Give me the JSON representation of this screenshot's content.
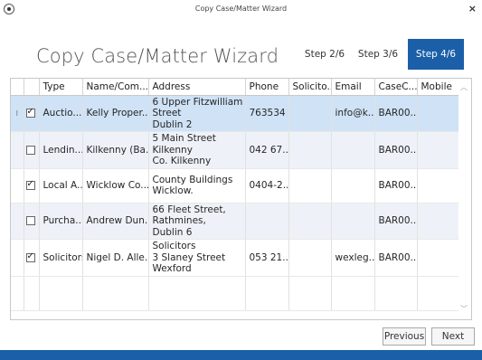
{
  "window": {
    "title": "Copy Case/Matter Wizard",
    "close": "×"
  },
  "heading": "Copy Case/Matter Wizard",
  "steps": [
    {
      "label": "Step 2/6"
    },
    {
      "label": "Step 3/6"
    },
    {
      "label": "Step 4/6"
    }
  ],
  "columns": [
    "Type",
    "Name/Com...",
    "Address",
    "Phone",
    "Solicito...",
    "Email",
    "CaseC...",
    "Mobile"
  ],
  "rows": [
    {
      "indicator": "I",
      "checked": true,
      "type": "Auctio...",
      "name": "Kelly Proper...",
      "address": [
        "6 Upper Fitzwilliam",
        "Street",
        "Dublin 2"
      ],
      "phone": "763534",
      "solicitor": "",
      "email": "info@k...",
      "casec": "BAR00...",
      "mobile": ""
    },
    {
      "indicator": "",
      "checked": false,
      "type": "Lendin...",
      "name": "Kilkenny (Ba...",
      "address": [
        "5 Main Street",
        "Kilkenny",
        "Co. Kilkenny"
      ],
      "phone": "042 67...",
      "solicitor": "",
      "email": "",
      "casec": "BAR00...",
      "mobile": ""
    },
    {
      "indicator": "",
      "checked": true,
      "type": "Local A...",
      "name": "Wicklow Co...",
      "address": [
        "County Buildings",
        "Wicklow."
      ],
      "phone": "0404-2...",
      "solicitor": "",
      "email": "",
      "casec": "BAR00...",
      "mobile": ""
    },
    {
      "indicator": "",
      "checked": false,
      "type": "Purcha...",
      "name": "Andrew Dun...",
      "address": [
        "66 Fleet Street,",
        "Rathmines,",
        "Dublin 6"
      ],
      "phone": "",
      "solicitor": "",
      "email": "",
      "casec": "BAR00...",
      "mobile": ""
    },
    {
      "indicator": "",
      "checked": true,
      "type": "Solicitors",
      "name": "Nigel D. Alle...",
      "address": [
        "Solicitors",
        "3 Slaney Street",
        "Wexford"
      ],
      "phone": "053 21...",
      "solicitor": "",
      "email": "wexleg...",
      "casec": "BAR00...",
      "mobile": ""
    }
  ],
  "buttons": {
    "previous": "Previous",
    "next": "Next"
  }
}
